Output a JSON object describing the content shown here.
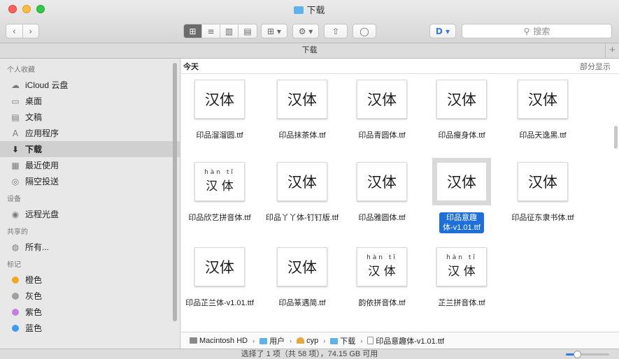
{
  "window": {
    "title": "下载"
  },
  "toolbar": {
    "nav": [
      "‹",
      "›"
    ],
    "view_modes": [
      "⊞",
      "≡",
      "▥",
      "▤"
    ],
    "group_by": "⊞ ▾",
    "action": "⚙ ▾",
    "share": "⇧",
    "tag": "◯",
    "app_menu": "D ▾",
    "search_placeholder": "搜索"
  },
  "tabbar": {
    "title": "下载",
    "add": "+"
  },
  "sidebar": {
    "favorites_header": "个人收藏",
    "favorites": [
      {
        "label": "iCloud 云盘",
        "icon": "☁"
      },
      {
        "label": "桌面",
        "icon": "▭"
      },
      {
        "label": "文稿",
        "icon": "▤"
      },
      {
        "label": "应用程序",
        "icon": "A"
      },
      {
        "label": "下载",
        "icon": "⬇"
      },
      {
        "label": "最近使用",
        "icon": "▦"
      },
      {
        "label": "隔空投送",
        "icon": "◎"
      }
    ],
    "devices_header": "设备",
    "devices": [
      {
        "label": "远程光盘",
        "icon": "◉"
      }
    ],
    "shared_header": "共享的",
    "shared": [
      {
        "label": "所有...",
        "icon": "◍"
      }
    ],
    "tags_header": "标记",
    "tags": [
      {
        "label": "橙色",
        "color": "#f5a623"
      },
      {
        "label": "灰色",
        "color": "#a0a0a0"
      },
      {
        "label": "紫色",
        "color": "#c77ddf"
      },
      {
        "label": "蓝色",
        "color": "#3b9cf4"
      }
    ]
  },
  "main": {
    "section_title": "今天",
    "show_less": "部分显示",
    "files": [
      {
        "name": "印品溜溜圆.ttf",
        "glyph": "汉体",
        "pinyin": ""
      },
      {
        "name": "印品抹茶体.ttf",
        "glyph": "汉体",
        "pinyin": ""
      },
      {
        "name": "印品青圆体.ttf",
        "glyph": "汉体",
        "pinyin": ""
      },
      {
        "name": "印品瘦身体.ttf",
        "glyph": "汉体",
        "pinyin": ""
      },
      {
        "name": "印品天逸黑.ttf",
        "glyph": "汉体",
        "pinyin": ""
      },
      {
        "name": "印品欣艺拼音体.ttf",
        "glyph": "汉 体",
        "pinyin": "hàn tǐ"
      },
      {
        "name": "印品丫丫体-钉钉版.ttf",
        "glyph": "汉体",
        "pinyin": ""
      },
      {
        "name": "印品雅圆体.ttf",
        "glyph": "汉体",
        "pinyin": ""
      },
      {
        "name": "印品意趣体-v1.01.ttf",
        "glyph": "汉体",
        "pinyin": ""
      },
      {
        "name": "印品征东隶书体.ttf",
        "glyph": "汉体",
        "pinyin": ""
      },
      {
        "name": "印品芷兰体-v1.01.ttf",
        "glyph": "汉体",
        "pinyin": ""
      },
      {
        "name": "印品篆遇简.ttf",
        "glyph": "汉体",
        "pinyin": ""
      },
      {
        "name": "韵依拼音体.ttf",
        "glyph": "汉 体",
        "pinyin": "hàn tǐ"
      },
      {
        "name": "芷兰拼音体.ttf",
        "glyph": "汉 体",
        "pinyin": "hàn tǐ"
      }
    ],
    "selected_index": 8
  },
  "pathbar": {
    "items": [
      "Macintosh HD",
      "用户",
      "cyp",
      "下载",
      "印品意趣体-v1.01.ttf"
    ],
    "separator": "›"
  },
  "statusbar": {
    "text": "选择了 1 项（共 58 项），74.15 GB 可用"
  },
  "colors": {
    "accent": "#1e6fd9",
    "folder_blue": "#5fb3ec"
  },
  "zoom_slider": {
    "value": 0.25
  }
}
